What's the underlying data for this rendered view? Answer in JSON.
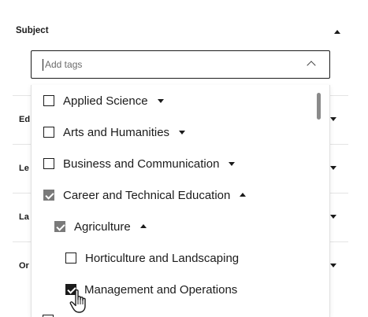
{
  "section": {
    "title": "Subject"
  },
  "tag_input": {
    "placeholder": "Add tags"
  },
  "background_rows": [
    {
      "label": "Ed"
    },
    {
      "label": "Le"
    },
    {
      "label": "La"
    },
    {
      "label": "Or"
    }
  ],
  "options": [
    {
      "label": "Applied Science",
      "checked": false,
      "expanded": false
    },
    {
      "label": "Arts and Humanities",
      "checked": false,
      "expanded": false
    },
    {
      "label": "Business and Communication",
      "checked": false,
      "expanded": false
    },
    {
      "label": "Career and Technical Education",
      "checked": true,
      "expanded": true
    },
    {
      "label": "Agriculture",
      "checked": true,
      "expanded": true
    },
    {
      "label": "Horticulture and Landscaping",
      "checked": false
    },
    {
      "label": "Management and Operations",
      "checked": true
    }
  ],
  "colors": {
    "text": "#1b1b1b",
    "checked_parent": "#7a7a7a",
    "checked_leaf": "#1b1b1b",
    "divider": "#e4e4e4"
  },
  "icons": {
    "collapse": "caret-up-icon",
    "expand": "caret-down-icon",
    "combo_toggle": "chevron-up-icon",
    "pointer": "hand-cursor-icon"
  }
}
